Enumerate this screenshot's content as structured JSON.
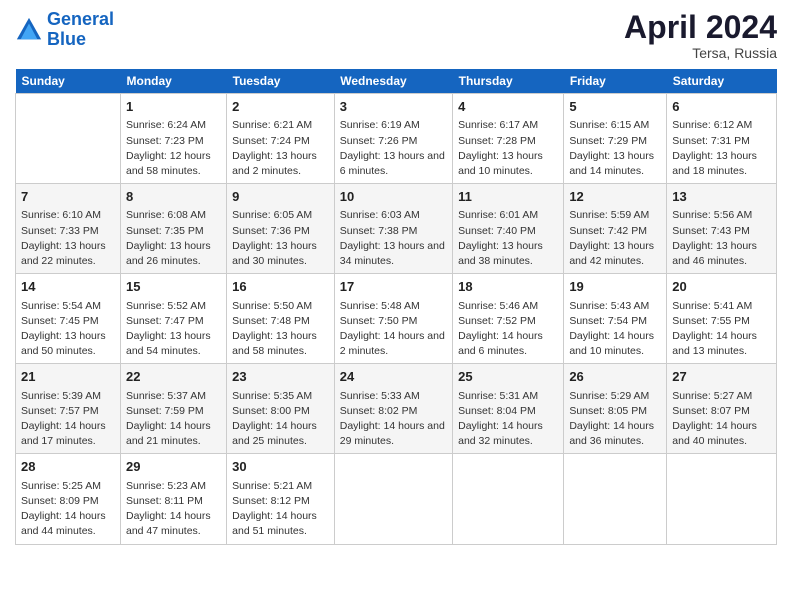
{
  "header": {
    "logo_line1": "General",
    "logo_line2": "Blue",
    "title": "April 2024",
    "subtitle": "Tersa, Russia"
  },
  "days_of_week": [
    "Sunday",
    "Monday",
    "Tuesday",
    "Wednesday",
    "Thursday",
    "Friday",
    "Saturday"
  ],
  "weeks": [
    [
      {
        "day": "",
        "sunrise": "",
        "sunset": "",
        "daylight": ""
      },
      {
        "day": "1",
        "sunrise": "Sunrise: 6:24 AM",
        "sunset": "Sunset: 7:23 PM",
        "daylight": "Daylight: 12 hours and 58 minutes."
      },
      {
        "day": "2",
        "sunrise": "Sunrise: 6:21 AM",
        "sunset": "Sunset: 7:24 PM",
        "daylight": "Daylight: 13 hours and 2 minutes."
      },
      {
        "day": "3",
        "sunrise": "Sunrise: 6:19 AM",
        "sunset": "Sunset: 7:26 PM",
        "daylight": "Daylight: 13 hours and 6 minutes."
      },
      {
        "day": "4",
        "sunrise": "Sunrise: 6:17 AM",
        "sunset": "Sunset: 7:28 PM",
        "daylight": "Daylight: 13 hours and 10 minutes."
      },
      {
        "day": "5",
        "sunrise": "Sunrise: 6:15 AM",
        "sunset": "Sunset: 7:29 PM",
        "daylight": "Daylight: 13 hours and 14 minutes."
      },
      {
        "day": "6",
        "sunrise": "Sunrise: 6:12 AM",
        "sunset": "Sunset: 7:31 PM",
        "daylight": "Daylight: 13 hours and 18 minutes."
      }
    ],
    [
      {
        "day": "7",
        "sunrise": "Sunrise: 6:10 AM",
        "sunset": "Sunset: 7:33 PM",
        "daylight": "Daylight: 13 hours and 22 minutes."
      },
      {
        "day": "8",
        "sunrise": "Sunrise: 6:08 AM",
        "sunset": "Sunset: 7:35 PM",
        "daylight": "Daylight: 13 hours and 26 minutes."
      },
      {
        "day": "9",
        "sunrise": "Sunrise: 6:05 AM",
        "sunset": "Sunset: 7:36 PM",
        "daylight": "Daylight: 13 hours and 30 minutes."
      },
      {
        "day": "10",
        "sunrise": "Sunrise: 6:03 AM",
        "sunset": "Sunset: 7:38 PM",
        "daylight": "Daylight: 13 hours and 34 minutes."
      },
      {
        "day": "11",
        "sunrise": "Sunrise: 6:01 AM",
        "sunset": "Sunset: 7:40 PM",
        "daylight": "Daylight: 13 hours and 38 minutes."
      },
      {
        "day": "12",
        "sunrise": "Sunrise: 5:59 AM",
        "sunset": "Sunset: 7:42 PM",
        "daylight": "Daylight: 13 hours and 42 minutes."
      },
      {
        "day": "13",
        "sunrise": "Sunrise: 5:56 AM",
        "sunset": "Sunset: 7:43 PM",
        "daylight": "Daylight: 13 hours and 46 minutes."
      }
    ],
    [
      {
        "day": "14",
        "sunrise": "Sunrise: 5:54 AM",
        "sunset": "Sunset: 7:45 PM",
        "daylight": "Daylight: 13 hours and 50 minutes."
      },
      {
        "day": "15",
        "sunrise": "Sunrise: 5:52 AM",
        "sunset": "Sunset: 7:47 PM",
        "daylight": "Daylight: 13 hours and 54 minutes."
      },
      {
        "day": "16",
        "sunrise": "Sunrise: 5:50 AM",
        "sunset": "Sunset: 7:48 PM",
        "daylight": "Daylight: 13 hours and 58 minutes."
      },
      {
        "day": "17",
        "sunrise": "Sunrise: 5:48 AM",
        "sunset": "Sunset: 7:50 PM",
        "daylight": "Daylight: 14 hours and 2 minutes."
      },
      {
        "day": "18",
        "sunrise": "Sunrise: 5:46 AM",
        "sunset": "Sunset: 7:52 PM",
        "daylight": "Daylight: 14 hours and 6 minutes."
      },
      {
        "day": "19",
        "sunrise": "Sunrise: 5:43 AM",
        "sunset": "Sunset: 7:54 PM",
        "daylight": "Daylight: 14 hours and 10 minutes."
      },
      {
        "day": "20",
        "sunrise": "Sunrise: 5:41 AM",
        "sunset": "Sunset: 7:55 PM",
        "daylight": "Daylight: 14 hours and 13 minutes."
      }
    ],
    [
      {
        "day": "21",
        "sunrise": "Sunrise: 5:39 AM",
        "sunset": "Sunset: 7:57 PM",
        "daylight": "Daylight: 14 hours and 17 minutes."
      },
      {
        "day": "22",
        "sunrise": "Sunrise: 5:37 AM",
        "sunset": "Sunset: 7:59 PM",
        "daylight": "Daylight: 14 hours and 21 minutes."
      },
      {
        "day": "23",
        "sunrise": "Sunrise: 5:35 AM",
        "sunset": "Sunset: 8:00 PM",
        "daylight": "Daylight: 14 hours and 25 minutes."
      },
      {
        "day": "24",
        "sunrise": "Sunrise: 5:33 AM",
        "sunset": "Sunset: 8:02 PM",
        "daylight": "Daylight: 14 hours and 29 minutes."
      },
      {
        "day": "25",
        "sunrise": "Sunrise: 5:31 AM",
        "sunset": "Sunset: 8:04 PM",
        "daylight": "Daylight: 14 hours and 32 minutes."
      },
      {
        "day": "26",
        "sunrise": "Sunrise: 5:29 AM",
        "sunset": "Sunset: 8:05 PM",
        "daylight": "Daylight: 14 hours and 36 minutes."
      },
      {
        "day": "27",
        "sunrise": "Sunrise: 5:27 AM",
        "sunset": "Sunset: 8:07 PM",
        "daylight": "Daylight: 14 hours and 40 minutes."
      }
    ],
    [
      {
        "day": "28",
        "sunrise": "Sunrise: 5:25 AM",
        "sunset": "Sunset: 8:09 PM",
        "daylight": "Daylight: 14 hours and 44 minutes."
      },
      {
        "day": "29",
        "sunrise": "Sunrise: 5:23 AM",
        "sunset": "Sunset: 8:11 PM",
        "daylight": "Daylight: 14 hours and 47 minutes."
      },
      {
        "day": "30",
        "sunrise": "Sunrise: 5:21 AM",
        "sunset": "Sunset: 8:12 PM",
        "daylight": "Daylight: 14 hours and 51 minutes."
      },
      {
        "day": "",
        "sunrise": "",
        "sunset": "",
        "daylight": ""
      },
      {
        "day": "",
        "sunrise": "",
        "sunset": "",
        "daylight": ""
      },
      {
        "day": "",
        "sunrise": "",
        "sunset": "",
        "daylight": ""
      },
      {
        "day": "",
        "sunrise": "",
        "sunset": "",
        "daylight": ""
      }
    ]
  ]
}
